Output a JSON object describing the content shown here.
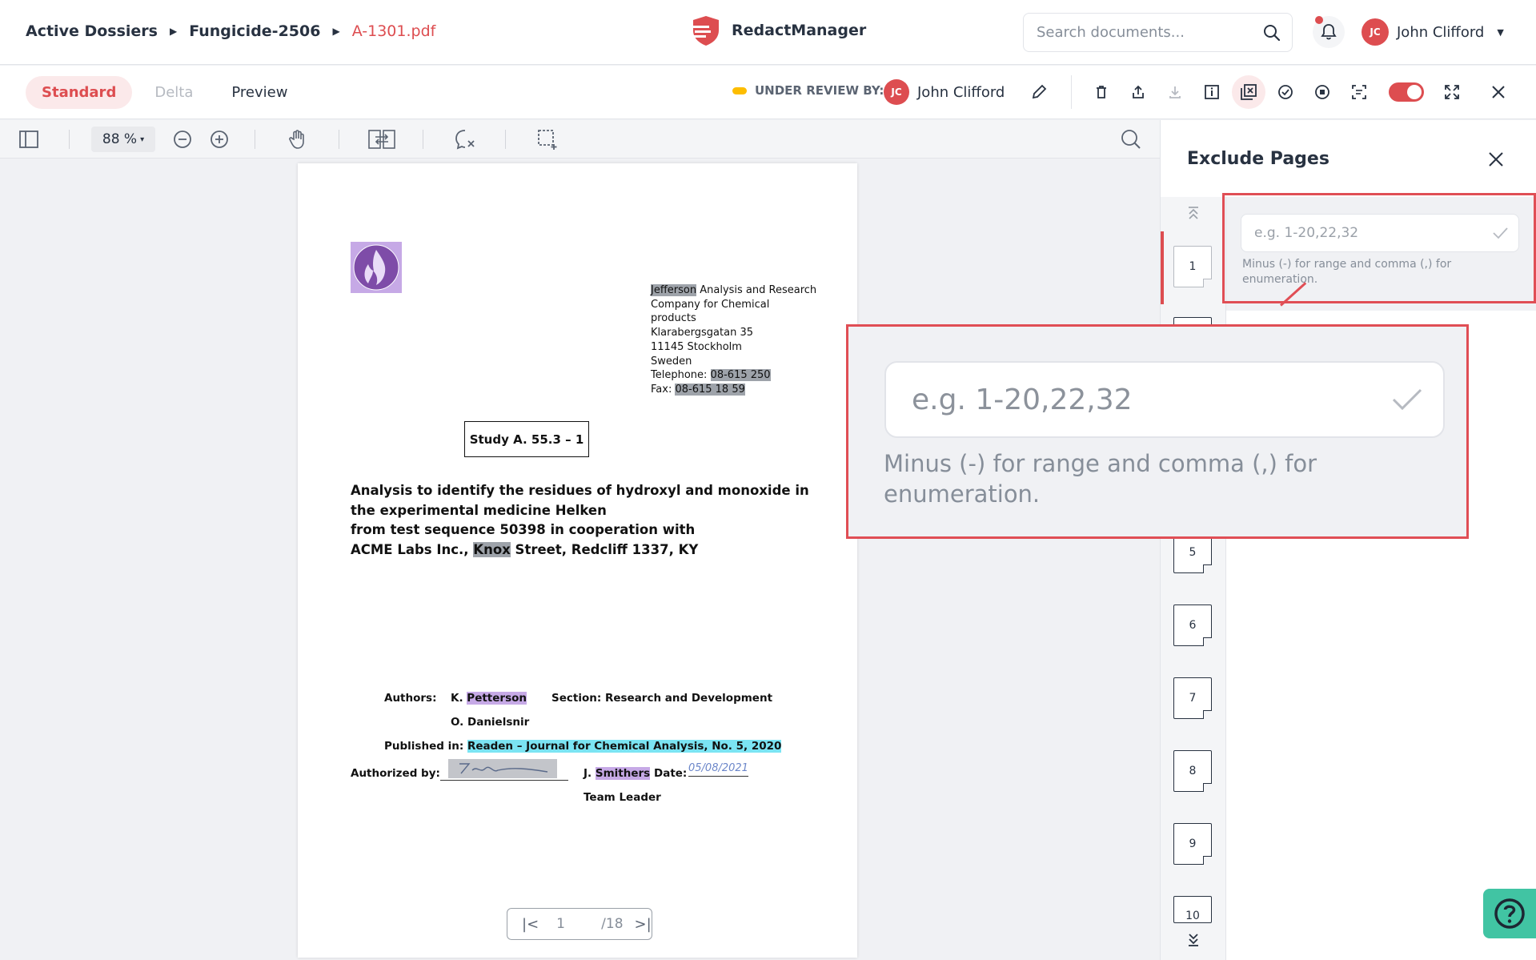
{
  "breadcrumb": {
    "root": "Active Dossiers",
    "dossier": "Fungicide-2506",
    "file": "A-1301.pdf"
  },
  "app": {
    "name": "RedactManager"
  },
  "search": {
    "placeholder": "Search documents..."
  },
  "user": {
    "initials": "JC",
    "name": "John Clifford"
  },
  "modes": {
    "standard": "Standard",
    "delta": "Delta",
    "preview": "Preview"
  },
  "review": {
    "label": "UNDER REVIEW BY:",
    "initials": "JC",
    "name": "John Clifford"
  },
  "viewer": {
    "zoom": "88 %"
  },
  "document": {
    "company_name": "Jefferson",
    "company_rest": " Analysis and Research",
    "address_lines": [
      "Company for Chemical",
      "products",
      "Klarabergsgatan 35",
      "11145 Stockholm",
      "Sweden"
    ],
    "telephone_label": "Telephone: ",
    "telephone": "08-615 250",
    "fax_label": "Fax: ",
    "fax": "08-615 18 59",
    "study": "Study A. 55.3 – 1",
    "title_lines": [
      "Analysis to identify the residues of hydroxyl and monoxide in",
      "the experimental medicine Helken",
      "from test sequence 50398 in cooperation with"
    ],
    "title_last_pre": "ACME Labs Inc., ",
    "title_last_hl": "Knox",
    "title_last_post": " Street, Redcliff 1337, KY",
    "authors_label": "Authors:",
    "author1_pre": "K. ",
    "author1_hl": "Petterson",
    "author2": "O. Danielsnir",
    "section": "Section: Research and Development",
    "published_label": "Published in: ",
    "published": "Readen – Journal for Chemical Analysis, No. 5, 2020",
    "authorized_label": "Authorized by:",
    "signer_pre": "J. ",
    "signer_hl": "Smithers",
    "date_label": "Date:",
    "date_value": "05/08/2021",
    "signer_role": "Team Leader"
  },
  "pager": {
    "current": "1",
    "total": "/18"
  },
  "panel": {
    "title": "Exclude Pages",
    "input_placeholder": "e.g. 1-20,22,32",
    "hint": "Minus (-) for range and comma (,) for enumeration.",
    "thumbnails": [
      "1",
      "5",
      "6",
      "7",
      "8",
      "9",
      "10"
    ]
  },
  "colors": {
    "accent": "#dd4d50",
    "highlight_box": "#e04e55",
    "help": "#41c4a3"
  }
}
